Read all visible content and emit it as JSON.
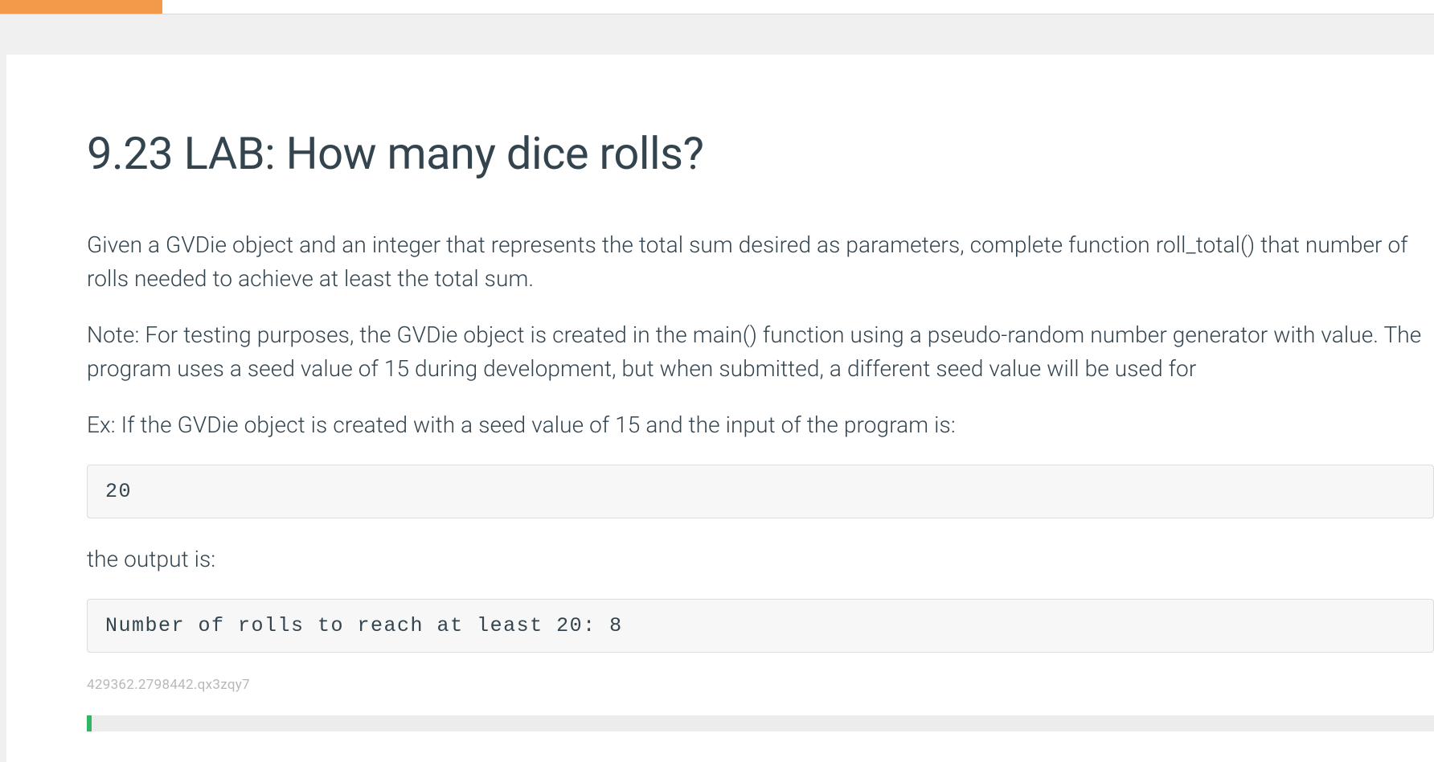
{
  "heading": "9.23 LAB: How many dice rolls?",
  "paragraphs": {
    "p1": "Given a GVDie object and an integer that represents the total sum desired as parameters, complete function roll_total() that number of rolls needed to achieve at least the total sum.",
    "p2": "Note: For testing purposes, the GVDie object is created in the main() function using a pseudo-random number generator with value. The program uses a seed value of 15 during development, but when submitted, a different seed value will be used for",
    "p3": "Ex: If the GVDie object is created with a seed value of 15 and the input of the program is:",
    "p4": "the output is:"
  },
  "code": {
    "input": "20",
    "output": "Number of rolls to reach at least 20: 8"
  },
  "smallId": "429362.2798442.qx3zqy7"
}
